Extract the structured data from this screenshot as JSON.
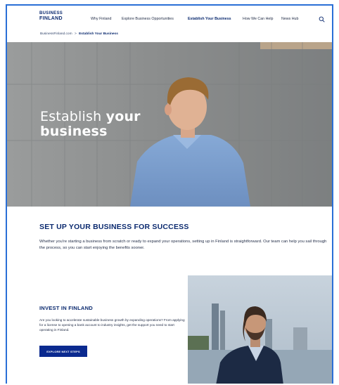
{
  "logo": {
    "line1": "BUSINESS",
    "line2": "FINLAND"
  },
  "nav": {
    "items": [
      {
        "label": "Why Finland"
      },
      {
        "label": "Explore Business Opportunities"
      },
      {
        "label": "Establish Your Business"
      },
      {
        "label": "How We Can Help"
      },
      {
        "label": "News Hub"
      }
    ],
    "active_index": 2,
    "search_icon": "search-icon"
  },
  "breadcrumb": {
    "home": "BusinessFinland.com",
    "separator": ">",
    "current": "Establish Your Business"
  },
  "hero": {
    "title_light": "Establish ",
    "title_bold_1": "your",
    "title_bold_2": "business"
  },
  "main": {
    "title": "SET UP YOUR BUSINESS FOR SUCCESS",
    "text": "Whether you're starting a business from scratch or ready to expand your operations, setting up in Finland is straightforward. Our team can help you sail through the process, so you can start enjoying the benefits sooner."
  },
  "invest": {
    "title": "INVEST IN FINLAND",
    "text": "Are you looking to accelerate sustainable business growth by expanding operations? From applying for a license to opening a bank account to industry insights, get the support you need to start operating in Finland.",
    "button": "EXPLORE NEXT STEPS"
  },
  "colors": {
    "brand": "#0b2a6f",
    "button": "#0b2a8f",
    "frame": "#2a6fd6"
  }
}
